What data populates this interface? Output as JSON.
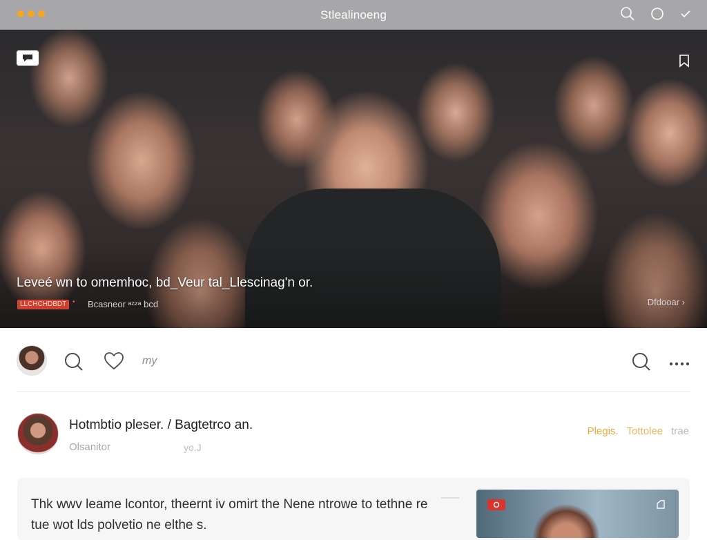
{
  "window": {
    "title": "Stlealinoeng",
    "traffic_colors": [
      "#f5a623",
      "#f5a623",
      "#f5a623"
    ],
    "toolbar_icons": [
      "search-icon",
      "circle-icon",
      "check-icon"
    ]
  },
  "hero": {
    "caption": "Leveé wn to omemhoc, bd_Veur tal_Llescinag'n or.",
    "badge": "LLCHCHDBDT",
    "meta": "Bcasneor  ᵃᶻᶻᵃ bcd",
    "right_label": "Dfdooar ›",
    "icons": [
      "chat-icon",
      "bookmark-icon"
    ]
  },
  "actionbar": {
    "label": "my",
    "icons": [
      "search-icon",
      "heart-icon",
      "search-icon",
      "more-icon"
    ]
  },
  "post": {
    "author": "Hotmbtio pleser. / Bagtetrco an.",
    "subtitle": "Olsanitor",
    "subtitle2": "yo.J",
    "tags": [
      "Plegis.",
      "Tottolee",
      "trae"
    ]
  },
  "comment": {
    "text": "Thk wwv leame lcontor, theernt iv omirt the Nene ntrowe to tethne re tue wot lds polvetio ne elthe s.",
    "thumb_badge_icon": "play-icon"
  },
  "colors": {
    "accent": "#f0a63a",
    "badge_red": "#c8402f",
    "titlebar": "#a7a6a8"
  }
}
